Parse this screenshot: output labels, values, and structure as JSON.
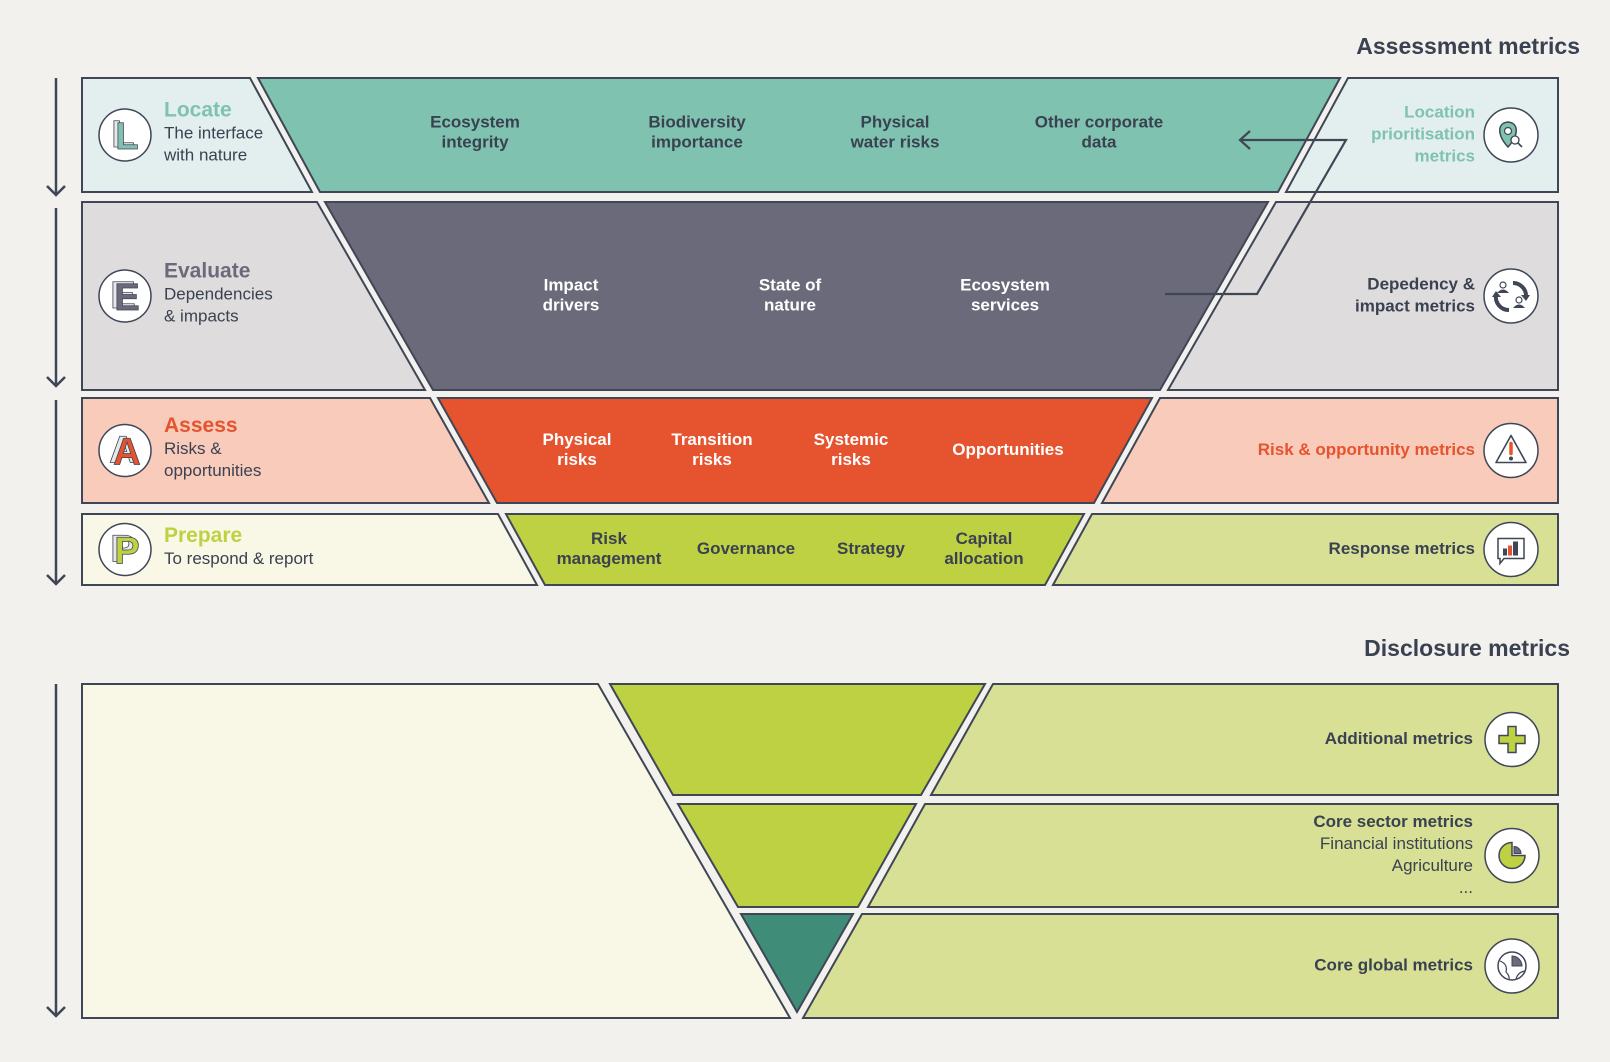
{
  "colors": {
    "background": "#f3f1ee",
    "outline": "#3f4656",
    "text_dark": "#3a4150",
    "locate_accent": "#7fc2b0",
    "locate_light": "#e2efee",
    "evaluate_accent": "#6b6a7b",
    "evaluate_light": "#dedcdc",
    "assess_accent": "#e5532f",
    "assess_light": "#f8cbbb",
    "prepare_accent": "#bed143",
    "prepare_light": "#f9f8e6",
    "response_light": "#d7e094",
    "disclosure_green": "#bed143",
    "disclosure_teal": "#3f8c79",
    "disclosure_light": "#d7e094"
  },
  "assessment": {
    "title": "Assessment metrics",
    "rows": [
      {
        "id": "locate",
        "letter": "L",
        "title": "Locate",
        "subtitle": [
          "The interface",
          "with nature"
        ],
        "items": [
          [
            "Ecosystem",
            "integrity"
          ],
          [
            "Biodiversity",
            "importance"
          ],
          [
            "Physical",
            "water risks"
          ],
          [
            "Other corporate",
            "data"
          ]
        ],
        "metric": [
          "Location",
          "prioritisation",
          "metrics"
        ],
        "metric_icon": "location-search-icon"
      },
      {
        "id": "evaluate",
        "letter": "E",
        "title": "Evaluate",
        "subtitle": [
          "Dependencies",
          "& impacts"
        ],
        "items": [
          [
            "Impact",
            "drivers"
          ],
          [
            "State of",
            "nature"
          ],
          [
            "Ecosystem",
            "services"
          ]
        ],
        "metric": [
          "Depedency &",
          "impact metrics"
        ],
        "metric_icon": "dependency-cycle-icon"
      },
      {
        "id": "assess",
        "letter": "A",
        "title": "Assess",
        "subtitle": [
          "Risks &",
          "opportunities"
        ],
        "items": [
          [
            "Physical",
            "risks"
          ],
          [
            "Transition",
            "risks"
          ],
          [
            "Systemic",
            "risks"
          ],
          [
            "Opportunities"
          ]
        ],
        "metric": [
          "Risk & opportunity metrics"
        ],
        "metric_icon": "warning-icon"
      },
      {
        "id": "prepare",
        "letter": "P",
        "title": "Prepare",
        "subtitle": [
          "To respond & report"
        ],
        "items": [
          [
            "Risk",
            "management"
          ],
          [
            "Governance"
          ],
          [
            "Strategy"
          ],
          [
            "Capital",
            "allocation"
          ]
        ],
        "metric": [
          "Response metrics"
        ],
        "metric_icon": "bar-chart-icon"
      }
    ]
  },
  "disclosure": {
    "title": "Disclosure metrics",
    "rows": [
      {
        "id": "additional",
        "lines": [
          "Additional metrics"
        ],
        "icon": "plus-icon"
      },
      {
        "id": "core-sector",
        "lines": [
          "Core sector metrics",
          "Financial institutions",
          "Agriculture",
          "..."
        ],
        "icon": "pie-icon"
      },
      {
        "id": "core-global",
        "lines": [
          "Core global metrics"
        ],
        "icon": "globe-icon"
      }
    ]
  }
}
